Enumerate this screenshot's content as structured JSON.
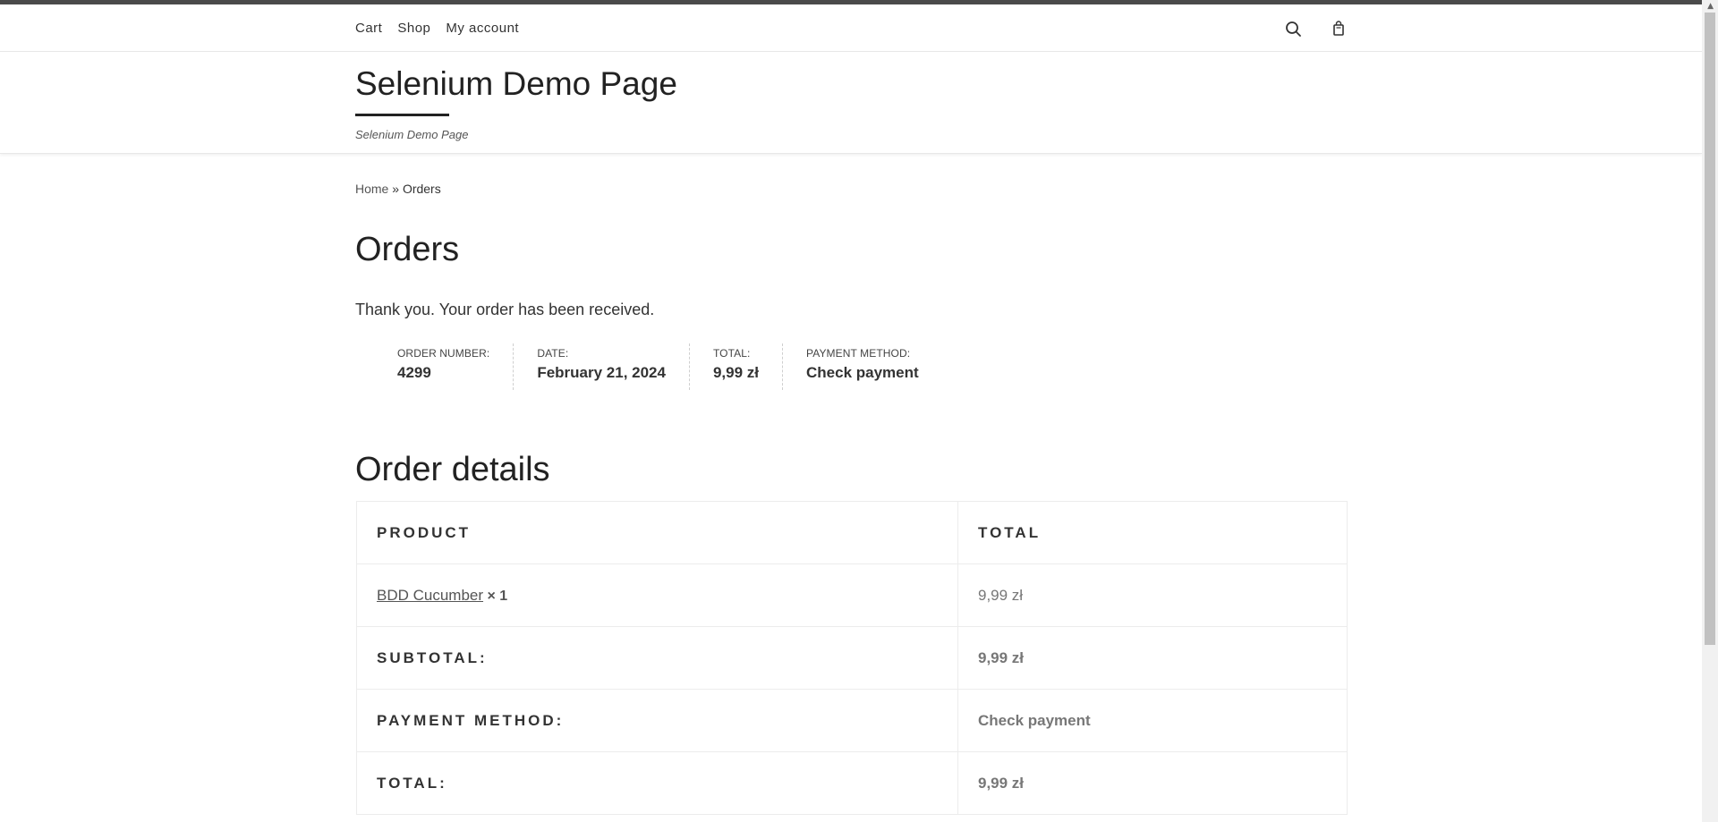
{
  "nav": {
    "links": [
      "Cart",
      "Shop",
      "My account"
    ],
    "search_icon": "search-icon",
    "cart_icon": "shopping-bag-icon"
  },
  "header": {
    "site_title": "Selenium Demo Page",
    "tagline": "Selenium Demo Page"
  },
  "breadcrumb": {
    "home": "Home",
    "separator": " » ",
    "current": "Orders"
  },
  "page": {
    "title": "Orders",
    "thank_you": "Thank you. Your order has been received."
  },
  "order_overview": [
    {
      "label": "ORDER NUMBER:",
      "value": "4299"
    },
    {
      "label": "DATE:",
      "value": "February 21, 2024"
    },
    {
      "label": "TOTAL:",
      "value": "9,99 zł"
    },
    {
      "label": "PAYMENT METHOD:",
      "value": "Check payment"
    }
  ],
  "order_details": {
    "title": "Order details",
    "headers": [
      "PRODUCT",
      "TOTAL"
    ],
    "product": {
      "name": "BDD Cucumber",
      "quantity": "× 1",
      "total": "9,99 zł"
    },
    "rows": [
      {
        "label": "SUBTOTAL:",
        "value": "9,99 zł"
      },
      {
        "label": "PAYMENT METHOD:",
        "value": "Check payment"
      },
      {
        "label": "TOTAL:",
        "value": "9,99 zł"
      }
    ]
  }
}
